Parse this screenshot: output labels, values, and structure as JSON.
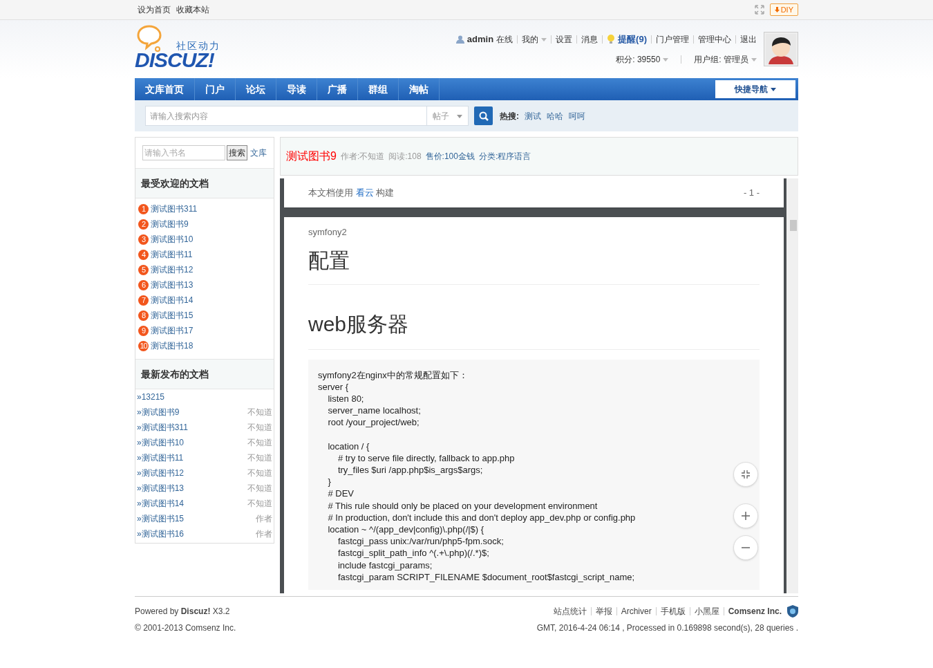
{
  "topbar": {
    "links": [
      "设为首页",
      "收藏本站"
    ],
    "diy_button": "DIY"
  },
  "logo": {
    "tagline": "社区动力",
    "wordmark": "DISCUZ!"
  },
  "user_menu": {
    "username": "admin",
    "status": "在线",
    "items": [
      {
        "label": "我的",
        "dropdown": true,
        "kind": "plain"
      },
      {
        "label": "设置",
        "dropdown": false,
        "kind": "plain"
      },
      {
        "label": "消息",
        "dropdown": false,
        "kind": "plain"
      },
      {
        "label": "提醒(9)",
        "dropdown": false,
        "kind": "alert"
      },
      {
        "label": "门户管理",
        "dropdown": false,
        "kind": "plain"
      },
      {
        "label": "管理中心",
        "dropdown": false,
        "kind": "plain"
      },
      {
        "label": "退出",
        "dropdown": false,
        "kind": "plain"
      }
    ],
    "credits": "积分: 39550",
    "group": "用户组: 管理员"
  },
  "nav": {
    "items": [
      "文库首页",
      "门户",
      "论坛",
      "导读",
      "广播",
      "群组",
      "淘帖"
    ],
    "quick_nav": "快捷导航"
  },
  "search": {
    "placeholder": "请输入搜索内容",
    "scope": "帖子",
    "hot_label": "热搜:",
    "hot_terms": [
      "测试",
      "哈哈",
      "呵呵"
    ]
  },
  "sidebar": {
    "book_search": {
      "placeholder": "请输入书名",
      "button": "搜索",
      "link": "文库"
    },
    "popular_title": "最受欢迎的文档",
    "popular": [
      {
        "rank": "1",
        "title": "测试图书311"
      },
      {
        "rank": "2",
        "title": "测试图书9"
      },
      {
        "rank": "3",
        "title": "测试图书10"
      },
      {
        "rank": "4",
        "title": "测试图书11"
      },
      {
        "rank": "5",
        "title": "测试图书12"
      },
      {
        "rank": "6",
        "title": "测试图书13"
      },
      {
        "rank": "7",
        "title": "测试图书14"
      },
      {
        "rank": "8",
        "title": "测试图书15"
      },
      {
        "rank": "9",
        "title": "测试图书17"
      },
      {
        "rank": "10",
        "title": "测试图书18"
      }
    ],
    "latest_title": "最新发布的文档",
    "latest": [
      {
        "title": "»13215"
      },
      {
        "title": "»测试图书9",
        "author": "不知道"
      },
      {
        "title": "»测试图书311",
        "author": "不知道"
      },
      {
        "title": "»测试图书10",
        "author": "不知道"
      },
      {
        "title": "»测试图书11",
        "author": "不知道"
      },
      {
        "title": "»测试图书12",
        "author": "不知道"
      },
      {
        "title": "»测试图书13",
        "author": "不知道"
      },
      {
        "title": "»测试图书14",
        "author": "不知道"
      },
      {
        "title": "»测试图书15",
        "author": "作者"
      },
      {
        "title": "»测试图书16",
        "author": "作者"
      }
    ]
  },
  "book": {
    "title": "测试图书9",
    "author": "作者:不知道",
    "reads": "阅读:108",
    "price": "售价:100金钱",
    "category": "分类:程序语言"
  },
  "viewer": {
    "built_with": "本文档使用",
    "builder": "看云",
    "built_suffix": "构建",
    "page_number": "- 1 -",
    "doc_label": "symfony2",
    "heading": "配置",
    "subheading": "web服务器",
    "code_blocks": [
      {
        "lines": [
          "symfony2在nginx中的常规配置如下：",
          "server {",
          "    listen 80;",
          "    server_name localhost;",
          "    root /your_project/web;"
        ]
      },
      {
        "lines": [
          "    location / {",
          "        # try to serve file directly, fallback to app.php",
          "        try_files $uri /app.php$is_args$args;",
          "    }",
          "    # DEV",
          "    # This rule should only be placed on your development environment",
          "    # In production, don't include this and don't deploy app_dev.php or config.php",
          "    location ~ ^/(app_dev|config)\\.php(/|$) {",
          "        fastcgi_pass unix:/var/run/php5-fpm.sock;",
          "        fastcgi_split_path_info ^(.+\\.php)(/.*)$;",
          "        include fastcgi_params;",
          "        fastcgi_param SCRIPT_FILENAME $document_root$fastcgi_script_name;"
        ]
      }
    ]
  },
  "footer": {
    "powered_prefix": "Powered by",
    "product": "Discuz!",
    "version": "X3.2",
    "copyright": "© 2001-2013 Comsenz Inc.",
    "links": [
      "站点统计",
      "举报",
      "Archiver",
      "手机版",
      "小黑屋"
    ],
    "company": "Comsenz Inc.",
    "stats": "GMT, 2016-4-24 06:14 , Processed in 0.169898 second(s), 28 queries ."
  }
}
